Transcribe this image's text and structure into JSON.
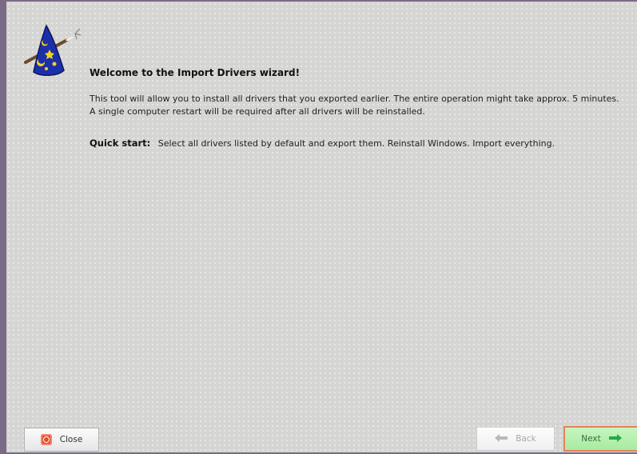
{
  "wizard": {
    "heading": "Welcome to the Import Drivers wizard!",
    "description": "This tool will allow you to install all drivers that you exported earlier. The entire operation might take approx. 5 minutes. A single computer restart will be required after all drivers will be reinstalled.",
    "quick_start_label": "Quick start:",
    "quick_start_text": "Select all drivers listed by default and export them. Reinstall Windows. Import everything."
  },
  "buttons": {
    "close_label": "Close",
    "back_label": "Back",
    "next_label": "Next"
  },
  "icons": {
    "wizard": "wizard-hat-icon",
    "close": "close-icon",
    "back": "arrow-left-icon",
    "next": "arrow-right-icon"
  },
  "colors": {
    "background": "#d5d5d3",
    "window_border": "#7a6a86",
    "next_background": "#b5efae",
    "next_border": "#e3835c",
    "close_icon": "#e24b2c"
  }
}
